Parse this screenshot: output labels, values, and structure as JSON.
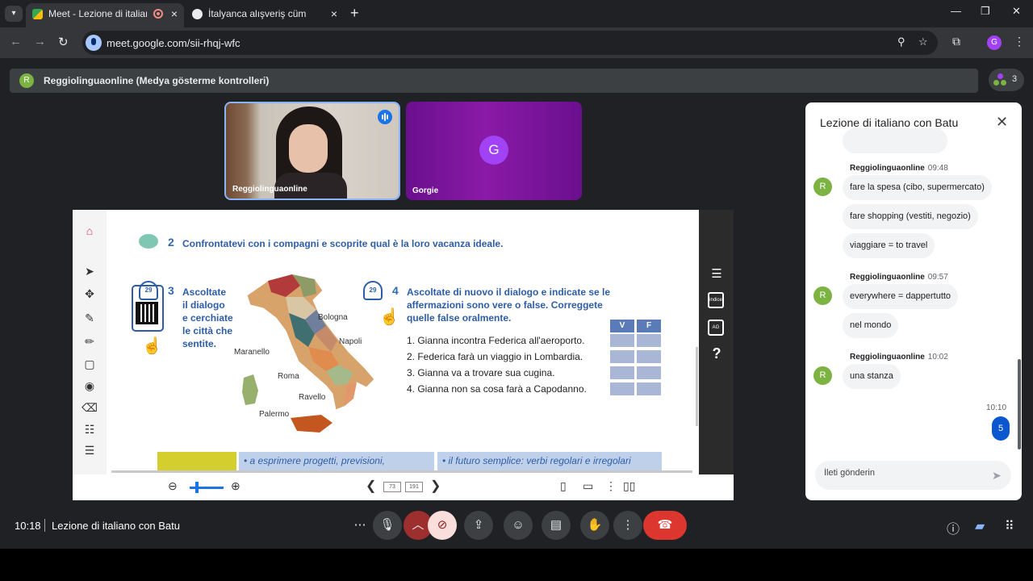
{
  "browser": {
    "tabs": [
      {
        "label": "Meet - Lezione di italiano c"
      },
      {
        "label": "İtalyanca alışveriş cümleleri"
      }
    ],
    "tab_close": "×",
    "new_tab": "+",
    "url": "meet.google.com/sii-rhqj-wfc",
    "profile_initial": "G",
    "window_controls": [
      "—",
      "❐",
      "✕"
    ],
    "accent": "#a8c7fa"
  },
  "meet": {
    "banner": {
      "avatar": "R",
      "text": "Reggiolinguaonline (Medya gösterme kontrolleri)"
    },
    "people_count": "3",
    "tiles": [
      {
        "name": "Reggiolinguaonline",
        "type": "video"
      },
      {
        "name": "Gorgie",
        "avatar": "G",
        "color": "#8a1aa7"
      }
    ],
    "presentation": {
      "exercise2": {
        "num": "2",
        "text": "Confrontatevi con i compagni e scoprite qual è la loro vacanza ideale."
      },
      "exercise3": {
        "num": "3",
        "track": "29",
        "lines": [
          "Ascoltate",
          "il dialogo",
          "e cerchiate",
          "le città che",
          "sentite."
        ]
      },
      "exercise4": {
        "num": "4",
        "track": "29",
        "lines": [
          "Ascoltate di nuovo il dialogo e indicate se le",
          "affermazioni sono vere o false. Correggete",
          "quelle false oralmente."
        ]
      },
      "map_labels": [
        "Bologna",
        "Napoli",
        "Maranello",
        "Roma",
        "Ravello",
        "Palermo"
      ],
      "vf_headers": [
        "V",
        "F"
      ],
      "statements": [
        "1.  Gianna incontra Federica all'aeroporto.",
        "2.  Federica farà un viaggio in Lombardia.",
        "3.  Gianna va a trovare sua cugina.",
        "4.  Gianna non sa cosa farà a Capodanno."
      ],
      "strip": [
        "• a esprimere progetti, previsioni,",
        "• il futuro semplice: verbi regolari e irregolari"
      ],
      "page_current": "73",
      "page_total": "191",
      "index_label": "indice",
      "ag_label": "AG"
    },
    "chat": {
      "title": "Lezione di italiano con Batu",
      "groups": [
        {
          "author": "Reggiolinguaonline",
          "time": "09:48",
          "avatar": "R",
          "messages": [
            "fare la spesa (cibo, supermercato)",
            "fare shopping (vestiti, negozio)",
            "viaggiare = to travel"
          ]
        },
        {
          "author": "Reggiolinguaonline",
          "time": "09:57",
          "avatar": "R",
          "messages": [
            "everywhere = dappertutto",
            "nel mondo"
          ]
        },
        {
          "author": "Reggiolinguaonline",
          "time": "10:02",
          "avatar": "R",
          "messages": [
            "una stanza"
          ]
        }
      ],
      "my_message": {
        "time": "10:10",
        "text": "5"
      },
      "input_placeholder": "İleti gönderin"
    },
    "bottom": {
      "clock": "10:18",
      "title": "Lezione di italiano con Batu"
    }
  }
}
